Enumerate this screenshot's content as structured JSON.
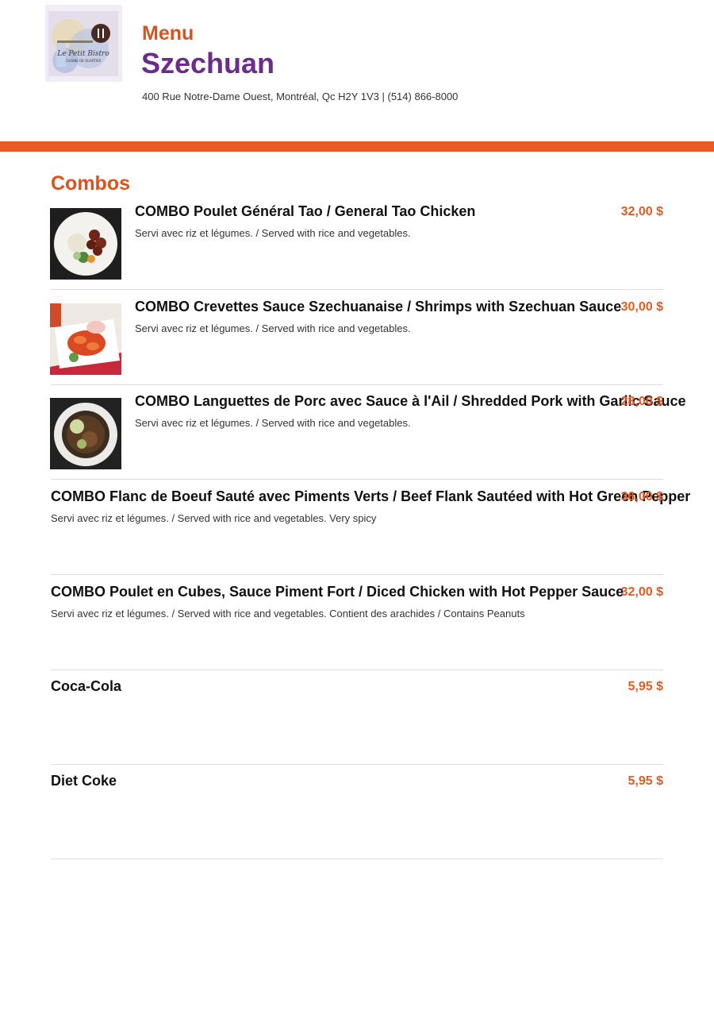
{
  "colors": {
    "accent": "#e85a22",
    "title_orange": "#d9541d",
    "name_purple": "#6b2c8e",
    "price": "#e15b22",
    "divider": "#dedede"
  },
  "header": {
    "logo_icon": "restaurant-logo-icon",
    "menu_label": "Menu",
    "restaurant_name": "Szechuan",
    "address": "400 Rue Notre-Dame Ouest, Montréal, Qc H2Y 1V3 | (514) 866-8000"
  },
  "section": {
    "title": "Combos"
  },
  "items": [
    {
      "name": "COMBO Poulet Général Tao / General Tao Chicken",
      "description": "Servi avec riz et légumes. / Served with rice and vegetables.",
      "price": "32,00 $",
      "photo": "general-tao-chicken-photo"
    },
    {
      "name": "COMBO Crevettes Sauce Szechuanaise / Shrimps with Szechuan Sauce",
      "description": "Servi avec riz et légumes. / Served with rice and vegetables.",
      "price": "30,00 $",
      "photo": "szechuan-shrimps-photo"
    },
    {
      "name": "COMBO Languettes de Porc avec Sauce à l'Ail / Shredded Pork with Garlic Sauce",
      "description": "Servi avec riz et légumes. / Served with rice and vegetables.",
      "price": "28,00 $",
      "photo": "shredded-pork-photo"
    },
    {
      "name": "COMBO Flanc de Boeuf Sauté avec Piments Verts / Beef Flank Sautéed with Hot Green Pepper",
      "description": "Servi avec riz et légumes. / Served with rice and vegetables. Very spicy",
      "price": "36,00 $",
      "photo": ""
    },
    {
      "name": "COMBO Poulet en Cubes, Sauce Piment Fort / Diced Chicken with Hot Pepper Sauce",
      "description": "Servi avec riz et légumes. / Served with rice and vegetables. Contient des arachides / Contains Peanuts",
      "price": "32,00 $",
      "photo": ""
    },
    {
      "name": "Coca-Cola",
      "description": "",
      "price": "5,95 $",
      "photo": ""
    },
    {
      "name": "Diet Coke",
      "description": "",
      "price": "5,95 $",
      "photo": ""
    }
  ]
}
